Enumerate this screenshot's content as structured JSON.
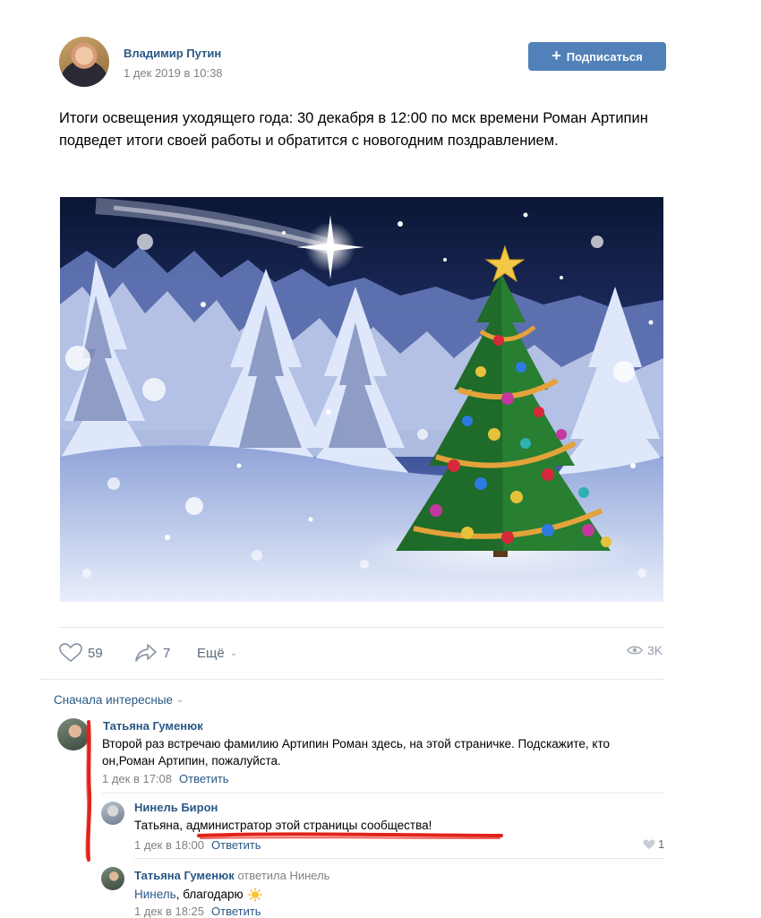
{
  "post": {
    "author": "Владимир Путин",
    "date": "1 дек 2019 в 10:38",
    "subscribe_label": "Подписаться",
    "subscribe_icon": "plus-icon",
    "text": "Итоги освещения уходящего года: 30 декабря в 12:00 по мск времени Роман Артипин подведет итоги своей работы и обратится с новогодним поздравлением.",
    "image_icon": "christmas-tree-image"
  },
  "actions": {
    "likes": "59",
    "shares": "7",
    "more_label": "Ещё",
    "views": "3K"
  },
  "comments": {
    "sort_label": "Сначала интересные",
    "items": [
      {
        "author": "Татьяна Гуменюк",
        "text": "Второй раз встречаю фамилию Артипин Роман здесь, на этой страничке. Подскажите, кто он,Роман Артипин, пожалуйста.",
        "date": "1 дек в 17:08",
        "reply_label": "Ответить"
      },
      {
        "author": "Нинель Бирон",
        "text": "Татьяна, администратор этой страницы сообщества!",
        "date": "1 дек в 18:00",
        "reply_label": "Ответить",
        "likes": "1"
      },
      {
        "author": "Татьяна Гуменюк",
        "replied_to": "ответила Нинель",
        "addressee": "Нинель",
        "text": ", благодарю",
        "emoji": "sun-emoji",
        "date": "1 дек в 18:25",
        "reply_label": "Ответить"
      }
    ]
  },
  "colors": {
    "link": "#2a5885",
    "button": "#5181b8",
    "muted": "#828282",
    "annotation": "#e0231a"
  }
}
